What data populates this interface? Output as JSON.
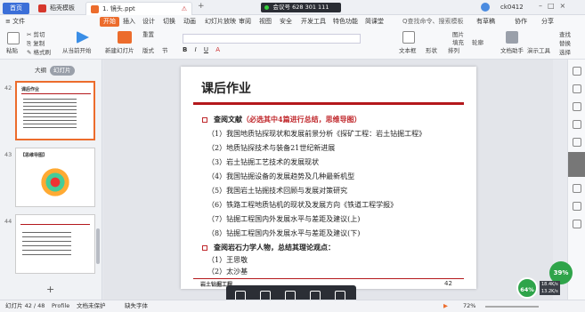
{
  "titlebar": {
    "home_tab": "首页",
    "tab1": "稻壳模板",
    "tab2": "1. 镜头.ppt",
    "recording": "会议号 628 301 111",
    "user": "ck0412"
  },
  "menu": {
    "file": "≡ 文件",
    "items": [
      "开始",
      "插入",
      "设计",
      "切换",
      "动画",
      "幻灯片放映",
      "审阅",
      "视图",
      "安全",
      "开发工具",
      "特色功能",
      "简课堂"
    ],
    "search": "Q查找命令、搜索模板",
    "share_label": "有草稿",
    "collab_label": "协作",
    "share": "分享"
  },
  "ribbon": {
    "cut": "剪切",
    "copy": "复制",
    "format": "格式刷",
    "paste": "粘贴",
    "from_current": "从当前开始",
    "new_slide": "新建幻灯片",
    "layout": "版式",
    "section": "节",
    "reset": "重置",
    "text_box": "文本框",
    "shape": "形状",
    "arrange": "排列",
    "outline": "轮廓",
    "picture": "图片",
    "fill": "填充",
    "text_tools": "文档助手",
    "present_tools": "演示工具",
    "find": "查找",
    "replace": "替换",
    "select": "选择"
  },
  "sidebar": {
    "tab_outline": "大纲",
    "tab_slides": "幻灯片",
    "slides": [
      {
        "num": "42",
        "title": "课后作业"
      },
      {
        "num": "43",
        "title": "【思维导图】"
      },
      {
        "num": "44",
        "title": ""
      }
    ],
    "add": "+"
  },
  "slide": {
    "title": "课后作业",
    "h1_prefix": "查阅文献",
    "h1_red": "（必选其中4篇进行总结，思维导图）",
    "items": [
      "（1）我国地质钻探现状和发展前景分析《探矿工程：岩土钻掘工程》",
      "（2）地质钻探技术与装备21世纪新进展",
      "（3）岩土钻掘工艺技术的发展现状",
      "（4）我国钻掘设备的发展趋势及几种最新机型",
      "（5）我国岩土钻掘技术回顾与发展对策研究",
      "（6）铁路工程地质钻机的现状及发展方向《铁道工程学报》",
      "（7）钻掘工程国内外发展水平与差距及建议(上)",
      "（8）钻掘工程国内外发展水平与差距及建议(下)"
    ],
    "h2": "查阅岩石力学人物，总结其理论观点：",
    "people": [
      "（1）王思敬",
      "（2）太沙基"
    ],
    "footer_left": "岩土钻掘工程",
    "page": "42"
  },
  "status": {
    "slide_pos": "幻灯片 42 / 48",
    "profile": "Profile",
    "protect": "文档未保护",
    "font_missing": "缺失字体",
    "zoom": "72%"
  },
  "badges": {
    "pct1": "39%",
    "pct2": "64%",
    "speed1": "18.4K/s",
    "speed2": "13.2K/s"
  }
}
